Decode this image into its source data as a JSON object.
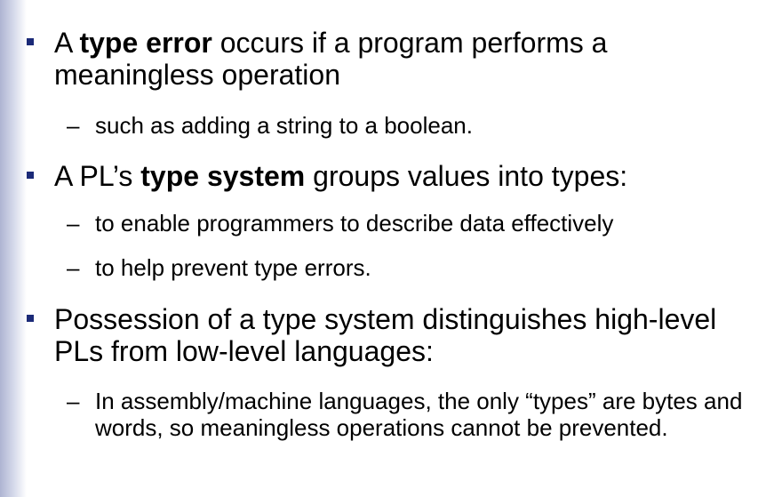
{
  "bullets": [
    {
      "pre": "A ",
      "bold": "type error",
      "post": " occurs if a program performs a meaningless operation",
      "subs": [
        "such as adding a string to a boolean."
      ]
    },
    {
      "pre": "A PL’s ",
      "bold": "type system",
      "post": " groups values into types:",
      "subs": [
        "to enable programmers to describe data effectively",
        "to help prevent type errors."
      ]
    },
    {
      "pre": "Possession of a type system distinguishes high-level PLs from low-level languages:",
      "bold": "",
      "post": "",
      "subs": [
        "In assembly/machine languages, the only “types” are bytes and words, so meaningless operations cannot be prevented."
      ]
    }
  ],
  "dash": "–",
  "colors": {
    "bullet": "#1b2a78",
    "sidebar_gradient": "#aeb4d2",
    "text": "#000000"
  }
}
